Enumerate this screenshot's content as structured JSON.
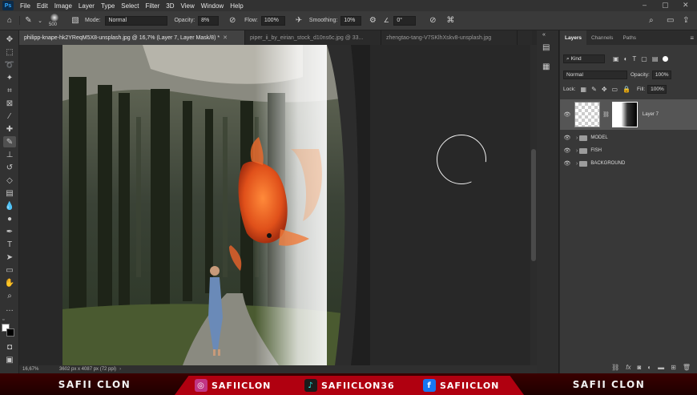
{
  "app": {
    "logo": "Ps",
    "menu": [
      "File",
      "Edit",
      "Image",
      "Layer",
      "Type",
      "Select",
      "Filter",
      "3D",
      "View",
      "Window",
      "Help"
    ],
    "window_controls": [
      "–",
      "▢",
      "✕"
    ]
  },
  "options": {
    "brush_size": "500",
    "mode_label": "Mode:",
    "mode_value": "Normal",
    "opacity_label": "Opacity:",
    "opacity_value": "8%",
    "flow_label": "Flow:",
    "flow_value": "100%",
    "smoothing_label": "Smoothing:",
    "smoothing_value": "10%",
    "angle_value": "0°"
  },
  "tabs": [
    {
      "label": "philipp-knape-hk2YReqM5X8-unsplash.jpg @ 16,7% (Layer 7, Layer Mask/8) *",
      "active": true
    },
    {
      "label": "piper_ii_by_eirian_stock_d10ns6c.jpg @ 33...",
      "active": false
    },
    {
      "label": "zhengtao-tang-V7SKlhXskv8-unsplash.jpg",
      "active": false
    }
  ],
  "status": {
    "zoom": "16,67%",
    "doc_size": "3602 px x 4087 px (72 ppi)"
  },
  "panel": {
    "tabs": [
      "Layers",
      "Channels",
      "Paths"
    ],
    "filter_kind": "Kind",
    "blend_mode": "Normal",
    "opacity_label": "Opacity:",
    "opacity_value": "100%",
    "lock_label": "Lock:",
    "fill_label": "Fill:",
    "fill_value": "100%",
    "layers": [
      {
        "name": "Layer 7",
        "type": "layer-with-mask",
        "selected": true
      },
      {
        "name": "MODEL",
        "type": "group"
      },
      {
        "name": "FISH",
        "type": "group"
      },
      {
        "name": "BACKGROUND",
        "type": "group"
      }
    ],
    "footer_icons": [
      "link-icon",
      "fx-icon",
      "mask-icon",
      "adjustment-icon",
      "folder-icon",
      "new-layer-icon",
      "trash-icon"
    ]
  },
  "banner": {
    "left_name": "SAFII CLON",
    "right_name": "SAFII CLON",
    "socials": [
      {
        "platform": "instagram",
        "handle": "SAFIICLON",
        "color": "#c13584"
      },
      {
        "platform": "tiktok",
        "handle": "SAFIICLON36",
        "color": "#1b1b1b"
      },
      {
        "platform": "facebook",
        "handle": "SAFIICLON",
        "color": "#1877f2"
      }
    ]
  }
}
